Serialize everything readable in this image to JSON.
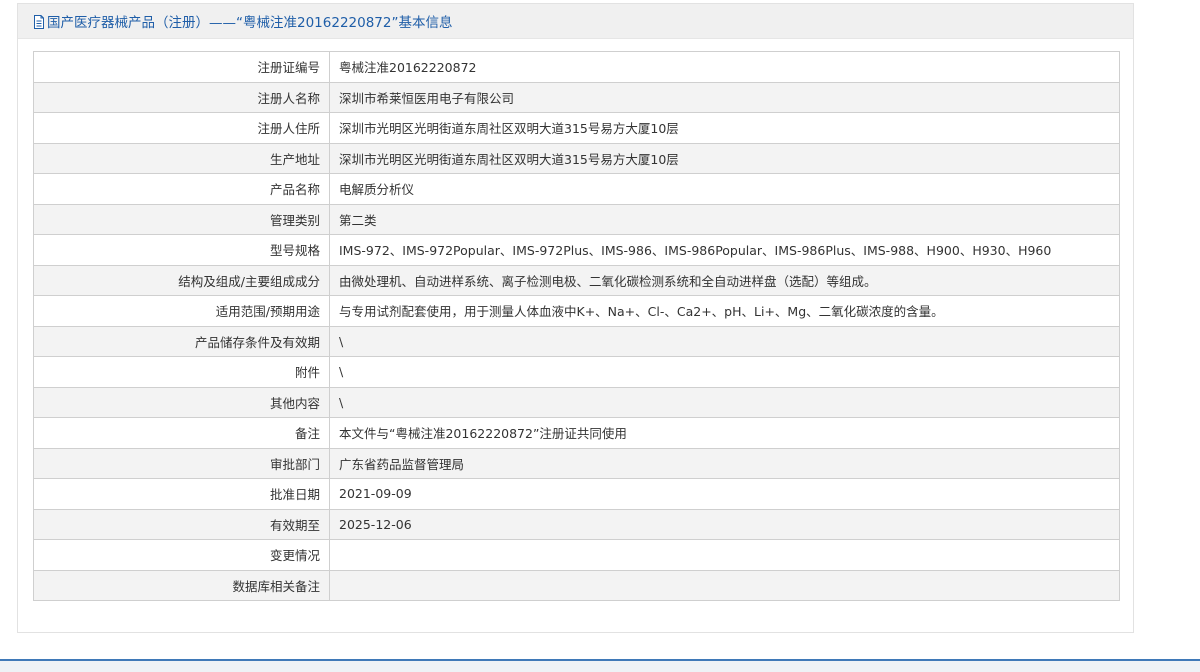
{
  "header": {
    "title": "国产医疗器械产品（注册）——“粤械注准20162220872”基本信息"
  },
  "rows": [
    {
      "label": "注册证编号",
      "value": "粤械注准20162220872"
    },
    {
      "label": "注册人名称",
      "value": "深圳市希莱恒医用电子有限公司"
    },
    {
      "label": "注册人住所",
      "value": "深圳市光明区光明街道东周社区双明大道315号易方大厦10层"
    },
    {
      "label": "生产地址",
      "value": "深圳市光明区光明街道东周社区双明大道315号易方大厦10层"
    },
    {
      "label": "产品名称",
      "value": "电解质分析仪"
    },
    {
      "label": "管理类别",
      "value": "第二类"
    },
    {
      "label": "型号规格",
      "value": "IMS-972、IMS-972Popular、IMS-972Plus、IMS-986、IMS-986Popular、IMS-986Plus、IMS-988、H900、H930、H960"
    },
    {
      "label": "结构及组成/主要组成成分",
      "value": "由微处理机、自动进样系统、离子检测电极、二氧化碳检测系统和全自动进样盘（选配）等组成。"
    },
    {
      "label": "适用范围/预期用途",
      "value": "与专用试剂配套使用，用于测量人体血液中K+、Na+、Cl-、Ca2+、pH、Li+、Mg、二氧化碳浓度的含量。"
    },
    {
      "label": "产品储存条件及有效期",
      "value": "\\"
    },
    {
      "label": "附件",
      "value": "\\"
    },
    {
      "label": "其他内容",
      "value": "\\"
    },
    {
      "label": "备注",
      "value": "本文件与“粤械注准20162220872”注册证共同使用"
    },
    {
      "label": "审批部门",
      "value": "广东省药品监督管理局"
    },
    {
      "label": "批准日期",
      "value": "2021-09-09"
    },
    {
      "label": "有效期至",
      "value": "2025-12-06"
    },
    {
      "label": "变更情况",
      "value": ""
    },
    {
      "label": "数据库相关备注",
      "value": ""
    }
  ],
  "colors": {
    "title": "#1f5ea8",
    "border": "#cfcfcf",
    "row_alt": "#f3f3f3",
    "header_bg": "#f0f0f0",
    "bottom_bar": "#3f79b8"
  },
  "icons": {
    "header_icon": "document-icon"
  }
}
